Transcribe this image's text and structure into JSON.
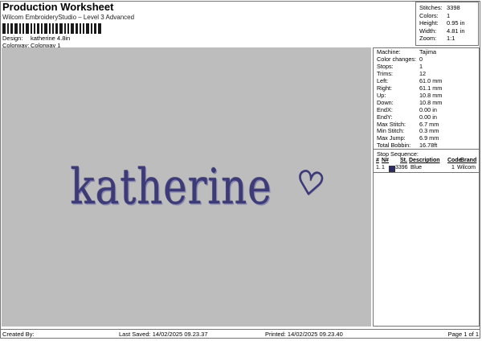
{
  "header": {
    "title": "Production Worksheet",
    "subtitle": "Wilcom EmbroideryStudio – Level 3 Advanced",
    "design_label": "Design:",
    "design_value": "katherine 4.8in",
    "colorway_label": "Colorway:",
    "colorway_value": "Colorway 1"
  },
  "summary": {
    "rows": [
      {
        "label": "Stitches:",
        "value": "3398"
      },
      {
        "label": "Colors:",
        "value": "1"
      },
      {
        "label": "Height:",
        "value": "0.95 in"
      },
      {
        "label": "Width:",
        "value": "4.81 in"
      },
      {
        "label": "Zoom:",
        "value": "1:1"
      }
    ]
  },
  "design_preview": {
    "text": "katherine",
    "heart": "♡",
    "stitch_color": "#3d3a78",
    "background_color": "#bdbdbd"
  },
  "machine_info": {
    "rows": [
      {
        "label": "Machine:",
        "value": "Tajima"
      },
      {
        "label": "Color changes:",
        "value": "0"
      },
      {
        "label": "Stops:",
        "value": "1"
      },
      {
        "label": "Trims:",
        "value": "12"
      },
      {
        "label": "Left:",
        "value": "61.0 mm"
      },
      {
        "label": "Right:",
        "value": "61.1 mm"
      },
      {
        "label": "Up:",
        "value": "10.8 mm"
      },
      {
        "label": "Down:",
        "value": "10.8 mm"
      },
      {
        "label": "EndX:",
        "value": "0.00 in"
      },
      {
        "label": "EndY:",
        "value": "0.00 in"
      },
      {
        "label": "Max Stitch:",
        "value": "6.7 mm"
      },
      {
        "label": "Min Stitch:",
        "value": "0.3 mm"
      },
      {
        "label": "Max Jump:",
        "value": "6.9 mm"
      },
      {
        "label": "Total Bobbin:",
        "value": "16.78ft"
      }
    ]
  },
  "stop_sequence": {
    "title": "Stop Sequence:",
    "columns": {
      "num": "#",
      "needle": "N#",
      "stitches": "St.",
      "description": "Description",
      "code": "Code",
      "brand": "Brand"
    },
    "rows": [
      {
        "num": "1.",
        "needle": "1",
        "stitches": "3396",
        "description": "Blue",
        "code": "1",
        "brand": "Wilcom",
        "swatch_color": "#2b2a6d"
      }
    ]
  },
  "footer": {
    "created_by": "Created By:",
    "last_saved": "Last Saved: 14/02/2025 09.23.37",
    "printed": "Printed: 14/02/2025 09.23.40",
    "page": "Page 1 of 1"
  }
}
